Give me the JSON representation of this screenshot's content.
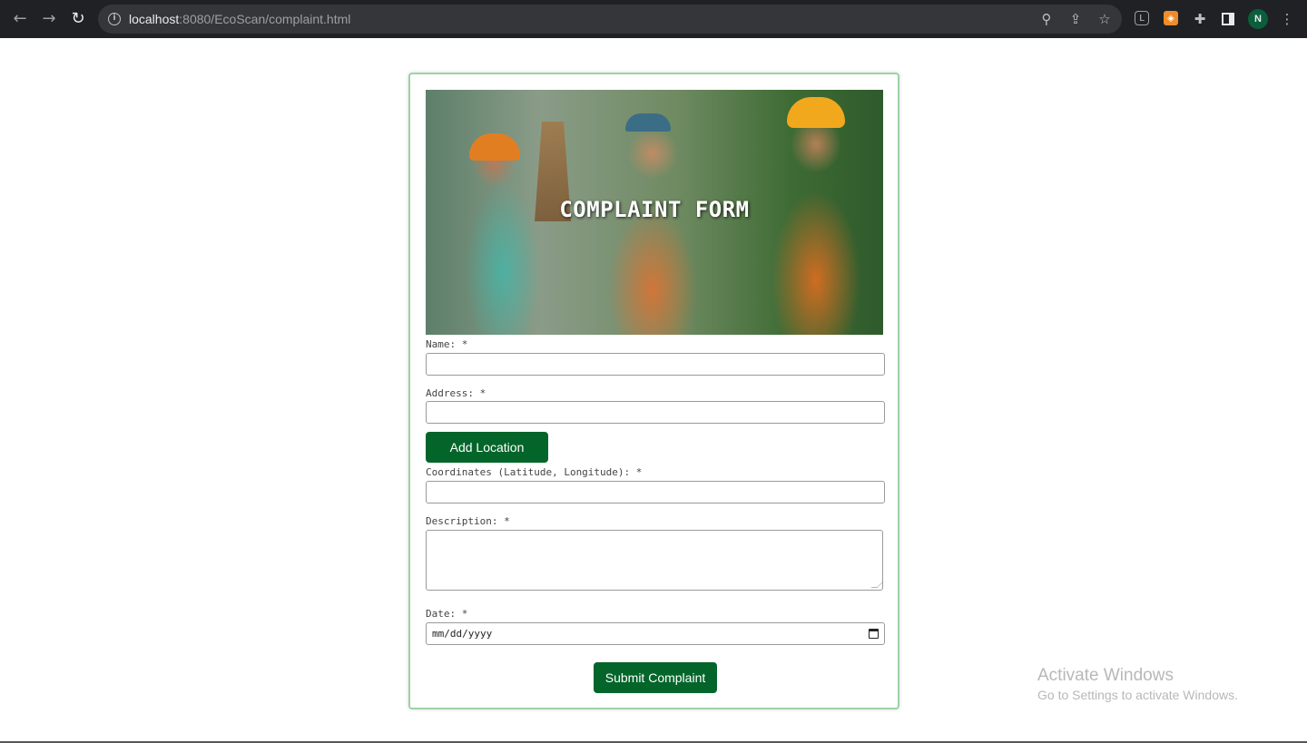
{
  "browser": {
    "url_host": "localhost",
    "url_path": ":8080/EcoScan/complaint.html",
    "avatar_initial": "N",
    "icons": [
      "back-arrow-icon",
      "forward-arrow-icon",
      "reload-icon",
      "site-info-icon",
      "zoom-icon",
      "share-icon",
      "star-icon",
      "extension-icon",
      "puzzle-icon",
      "side-panel-icon",
      "more-menu-icon"
    ]
  },
  "form": {
    "banner_title": "COMPLAINT FORM",
    "name_label": "Name: *",
    "name_value": "",
    "address_label": "Address: *",
    "address_value": "",
    "add_location_button": "Add Location",
    "coordinates_label": "Coordinates (Latitude, Longitude): *",
    "coordinates_value": "",
    "description_label": "Description: *",
    "description_value": "",
    "date_label": "Date: *",
    "date_placeholder": "mm/dd/yyyy",
    "submit_button": "Submit Complaint",
    "accent_color": "#04652a",
    "card_border_color": "#9bd3a6"
  },
  "watermark": {
    "title": "Activate Windows",
    "subtitle": "Go to Settings to activate Windows."
  }
}
